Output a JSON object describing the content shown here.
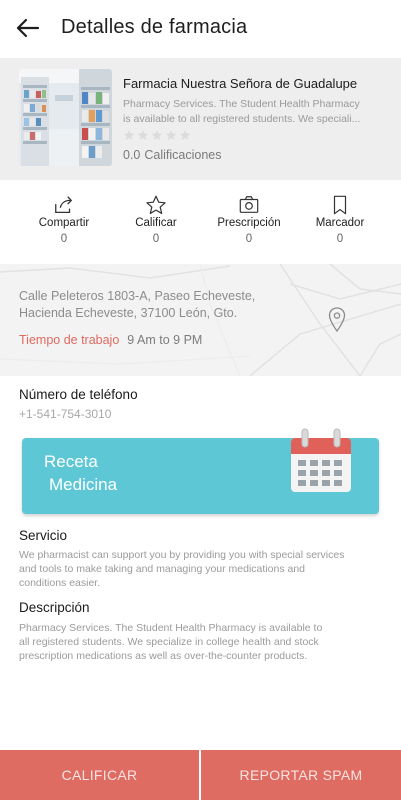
{
  "header": {
    "title": "Detalles de farmacia"
  },
  "pharmacy": {
    "name": "Farmacia Nuestra Señora de Guadalupe",
    "description_line1": "Pharmacy Services. The Student Health Pharmacy",
    "description_line2": "is available to all registered students. We speciali...",
    "rating_value": "0.0",
    "rating_label": "Calificaciones",
    "stars_filled": 0,
    "stars_total": 5
  },
  "actions": [
    {
      "label": "Compartir",
      "count": "0",
      "icon": "share-icon"
    },
    {
      "label": "Calificar",
      "count": "0",
      "icon": "star-icon"
    },
    {
      "label": "Prescripción",
      "count": "0",
      "icon": "camera-icon"
    },
    {
      "label": "Marcador",
      "count": "0",
      "icon": "bookmark-icon"
    }
  ],
  "location": {
    "address_line1": "Calle Peleteros 1803-A, Paseo Echeveste,",
    "address_line2": "Hacienda Echeveste, 37100 León, Gto.",
    "hours_label": "Tiempo de trabajo",
    "hours_value": "9 Am to 9 PM"
  },
  "phone": {
    "label": "Número de teléfono",
    "value": "+1-541-754-3010"
  },
  "banner": {
    "line1": "Receta",
    "line2": "Medicina",
    "icon": "calendar-icon"
  },
  "service": {
    "heading": "Servicio",
    "line1": "We pharmacist can support you by providing you with special services",
    "line2": "and tools to make taking and managing your medications and",
    "line3": "conditions easier."
  },
  "description": {
    "heading": "Descripción",
    "line1": "Pharmacy Services. The Student Health Pharmacy is available to",
    "line2": "all registered students. We specialize in college health and stock",
    "line3": "prescription medications as well as over-the-counter products."
  },
  "bottom": {
    "rate_label": "CALIFICAR",
    "spam_label": "REPORTAR SPAM"
  },
  "colors": {
    "accent": "#de6c63",
    "banner": "#5ec7d6",
    "hours_label": "#e06a5f"
  }
}
